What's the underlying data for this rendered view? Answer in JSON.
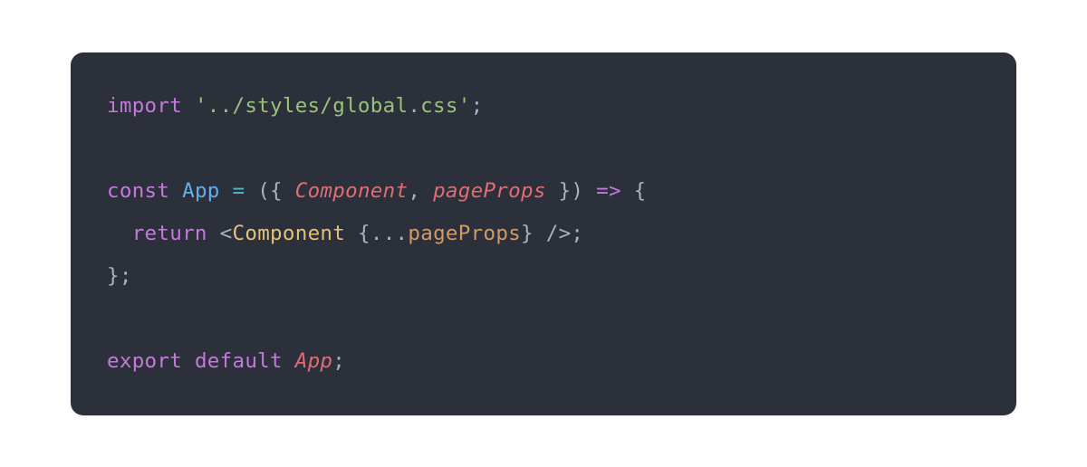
{
  "code": {
    "line1": {
      "import": "import",
      "path": "'../styles/global.css'",
      "semi": ";"
    },
    "line3": {
      "const": "const",
      "name": "App",
      "eq": " = ",
      "lparen": "({ ",
      "param1": "Component",
      "comma": ",",
      "space": " ",
      "param2": "pageProps",
      "rparen": " })",
      "arrow": " => ",
      "lbrace": "{"
    },
    "line4": {
      "indent": "  ",
      "return": "return",
      "space": " ",
      "lt": "<",
      "comp": "Component",
      "space2": " ",
      "spreadOpen": "{",
      "spread": "...",
      "spreadVar": "pageProps",
      "spreadClose": "}",
      "slashgt": " />",
      "semi": ";"
    },
    "line5": {
      "rbrace": "}",
      "semi": ";"
    },
    "line7": {
      "export": "export",
      "default": "default",
      "name": "App",
      "semi": ";"
    }
  }
}
